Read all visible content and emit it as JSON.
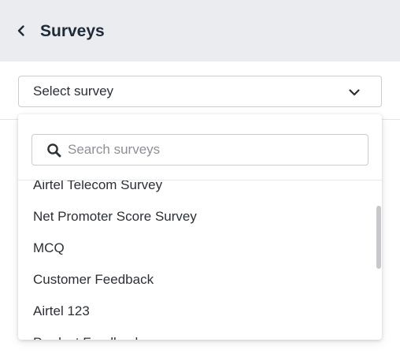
{
  "header": {
    "title": "Surveys",
    "back_icon": "chevron-left-icon",
    "background": "#ebecef"
  },
  "select": {
    "label": "Select survey",
    "icon": "chevron-down-icon"
  },
  "dropdown": {
    "search": {
      "placeholder": "Search surveys",
      "value": "",
      "icon": "search-icon"
    },
    "items": [
      {
        "label": "Airtel Telecom Survey"
      },
      {
        "label": "Net Promoter Score Survey"
      },
      {
        "label": "MCQ"
      },
      {
        "label": "Customer Feedback"
      },
      {
        "label": "Airtel 123"
      },
      {
        "label": "Product Feedback"
      }
    ]
  },
  "colors": {
    "text": "#2b2f36",
    "border": "#c9ccd1",
    "scrollbar": "#c6c8cc"
  }
}
